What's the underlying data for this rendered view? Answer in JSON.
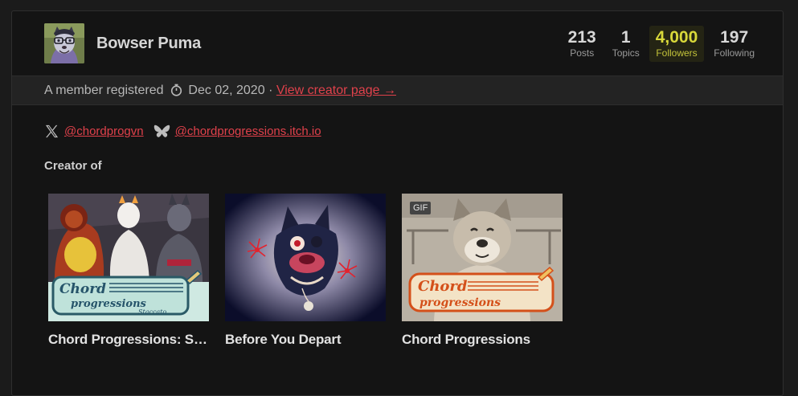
{
  "profile": {
    "username": "Bowser Puma",
    "avatar_icon": "puma-avatar"
  },
  "stats": [
    {
      "value": "213",
      "label": "Posts"
    },
    {
      "value": "1",
      "label": "Topics"
    },
    {
      "value": "4,000",
      "label": "Followers"
    },
    {
      "value": "197",
      "label": "Following"
    }
  ],
  "registration": {
    "prefix": "A member registered",
    "date": "Dec 02, 2020",
    "separator": "·",
    "creator_link": "View creator page →"
  },
  "socials": [
    {
      "icon": "x-twitter-icon",
      "handle": "@chordprogvn"
    },
    {
      "icon": "bluesky-butterfly-icon",
      "handle": "@chordprogressions.itch.io"
    }
  ],
  "creator_of_heading": "Creator of",
  "games": [
    {
      "title": "Chord Progressions: St…",
      "badge": ""
    },
    {
      "title": "Before You Depart",
      "badge": ""
    },
    {
      "title": "Chord Progressions",
      "badge": "GIF"
    }
  ],
  "colors": {
    "background": "#141414",
    "link": "#e0414b",
    "followers_highlight": "#d8d83a"
  }
}
